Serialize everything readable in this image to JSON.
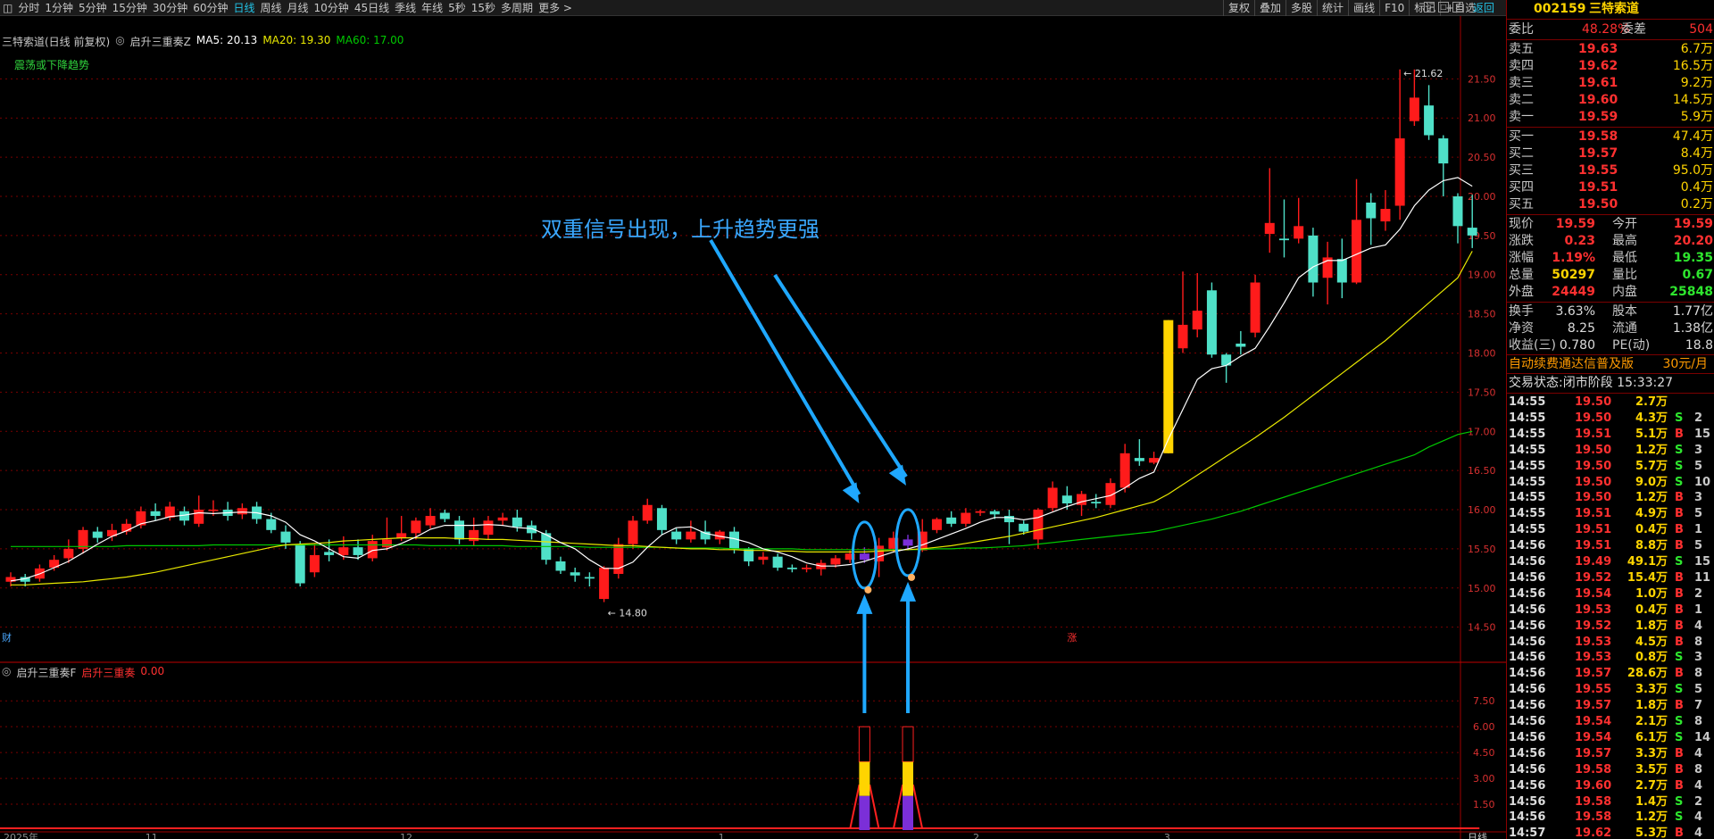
{
  "toolbar": {
    "periods": [
      "分时",
      "1分钟",
      "5分钟",
      "15分钟",
      "30分钟",
      "60分钟",
      "日线",
      "周线",
      "月线",
      "10分钟",
      "45日线",
      "季线",
      "年线",
      "5秒",
      "15秒",
      "多周期",
      "更多 >"
    ],
    "active_period": "日线",
    "tools": [
      "复权",
      "叠加",
      "多股",
      "统计",
      "画线",
      "F10",
      "标记",
      "+自选"
    ],
    "back": "返回"
  },
  "chart_header": {
    "title": "三特索道(日线 前复权)",
    "indicator": "启升三重奏Z",
    "ma5": "MA5: 20.13",
    "ma20": "MA20: 19.30",
    "ma60": "MA60: 17.00",
    "trend_label": "震荡或下降趋势",
    "annotation": "双重信号出现，上升趋势更强",
    "high_label": "21.62",
    "low_label": "14.80",
    "finance_marker": "财",
    "rise_marker": "涨",
    "sub_title": "启升三重奏F",
    "sub_name": "启升三重奏",
    "sub_value": "0.00",
    "axis_bottom": [
      "2025年",
      "11",
      "12",
      "1",
      "2",
      "3"
    ],
    "axis_corner": "日线"
  },
  "chart_data": {
    "type": "candlestick",
    "price_axis": [
      "21.50",
      "21.00",
      "20.50",
      "20.00",
      "19.50",
      "19.00",
      "18.50",
      "18.00",
      "17.50",
      "17.00",
      "16.50",
      "16.00",
      "15.50",
      "15.00",
      "14.50"
    ],
    "sub_axis": [
      "7.50",
      "6.00",
      "4.50",
      "3.00",
      "1.50"
    ],
    "ylim": [
      14.2,
      21.8
    ],
    "colors": {
      "up": "#ff1b1b",
      "down": "#4fe0c8",
      "ma5": "#ffffff",
      "ma20": "#e8e800",
      "ma60": "#00c800",
      "signal": "#7b2fd8",
      "limit": "#ffd400"
    },
    "candles": [
      [
        15.08,
        15.14,
        15.2,
        15.02
      ],
      [
        15.14,
        15.08,
        15.18,
        15.02
      ],
      [
        15.12,
        15.25,
        15.3,
        15.08
      ],
      [
        15.26,
        15.36,
        15.42,
        15.22
      ],
      [
        15.38,
        15.5,
        15.62,
        15.32
      ],
      [
        15.5,
        15.74,
        15.78,
        15.44
      ],
      [
        15.72,
        15.64,
        15.78,
        15.58
      ],
      [
        15.66,
        15.74,
        15.82,
        15.6
      ],
      [
        15.72,
        15.82,
        15.88,
        15.68
      ],
      [
        15.8,
        15.98,
        16.04,
        15.76
      ],
      [
        15.98,
        15.92,
        16.08,
        15.86
      ],
      [
        15.9,
        16.04,
        16.1,
        15.86
      ],
      [
        15.98,
        15.86,
        16.04,
        15.8
      ],
      [
        15.82,
        16.0,
        16.18,
        15.78
      ],
      [
        16.0,
        16.0,
        16.12,
        15.92
      ],
      [
        16.0,
        15.92,
        16.1,
        15.86
      ],
      [
        15.94,
        16.02,
        16.08,
        15.88
      ],
      [
        16.04,
        15.88,
        16.1,
        15.82
      ],
      [
        15.88,
        15.74,
        15.96,
        15.7
      ],
      [
        15.72,
        15.58,
        15.8,
        15.5
      ],
      [
        15.56,
        15.06,
        15.6,
        15.02
      ],
      [
        15.2,
        15.42,
        15.56,
        15.14
      ],
      [
        15.46,
        15.42,
        15.62,
        15.34
      ],
      [
        15.42,
        15.52,
        15.66,
        15.36
      ],
      [
        15.52,
        15.42,
        15.62,
        15.36
      ],
      [
        15.38,
        15.6,
        15.68,
        15.34
      ],
      [
        15.52,
        15.62,
        15.9,
        15.48
      ],
      [
        15.64,
        15.7,
        15.92,
        15.6
      ],
      [
        15.7,
        15.86,
        15.9,
        15.62
      ],
      [
        15.8,
        15.92,
        16.02,
        15.76
      ],
      [
        15.96,
        15.88,
        16.0,
        15.84
      ],
      [
        15.86,
        15.62,
        15.92,
        15.56
      ],
      [
        15.6,
        15.74,
        15.9,
        15.54
      ],
      [
        15.68,
        15.86,
        15.92,
        15.62
      ],
      [
        15.86,
        15.9,
        15.96,
        15.8
      ],
      [
        15.9,
        15.78,
        16.0,
        15.72
      ],
      [
        15.8,
        15.7,
        15.86,
        15.62
      ],
      [
        15.7,
        15.36,
        15.74,
        15.3
      ],
      [
        15.34,
        15.22,
        15.4,
        15.18
      ],
      [
        15.2,
        15.16,
        15.26,
        15.08
      ],
      [
        15.14,
        15.12,
        15.2,
        15.02
      ],
      [
        14.86,
        15.26,
        15.28,
        14.82
      ],
      [
        15.18,
        15.56,
        15.64,
        15.12
      ],
      [
        15.56,
        15.86,
        15.92,
        15.5
      ],
      [
        15.86,
        16.06,
        16.14,
        15.82
      ],
      [
        16.02,
        15.74,
        16.06,
        15.68
      ],
      [
        15.72,
        15.62,
        15.76,
        15.56
      ],
      [
        15.62,
        15.72,
        15.86,
        15.58
      ],
      [
        15.72,
        15.62,
        15.86,
        15.56
      ],
      [
        15.62,
        15.72,
        15.74,
        15.56
      ],
      [
        15.72,
        15.5,
        15.78,
        15.44
      ],
      [
        15.5,
        15.34,
        15.52,
        15.28
      ],
      [
        15.36,
        15.4,
        15.46,
        15.3
      ],
      [
        15.4,
        15.26,
        15.44,
        15.22
      ],
      [
        15.26,
        15.24,
        15.3,
        15.2
      ],
      [
        15.24,
        15.26,
        15.3,
        15.2
      ],
      [
        15.24,
        15.32,
        15.36,
        15.16
      ],
      [
        15.3,
        15.38,
        15.42,
        15.26
      ],
      [
        15.36,
        15.44,
        15.48,
        15.32
      ],
      [
        15.36,
        15.44,
        15.52,
        15.32
      ],
      [
        15.34,
        15.54,
        15.64,
        15.14
      ],
      [
        15.5,
        15.64,
        15.72,
        15.46
      ],
      [
        15.62,
        15.54,
        15.68,
        15.48
      ],
      [
        15.48,
        15.72,
        15.88,
        15.46
      ],
      [
        15.74,
        15.88,
        15.9,
        15.7
      ],
      [
        15.9,
        15.82,
        15.98,
        15.78
      ],
      [
        15.82,
        15.96,
        16.02,
        15.78
      ],
      [
        15.96,
        15.98,
        16.0,
        15.92
      ],
      [
        15.98,
        15.94,
        16.0,
        15.88
      ],
      [
        15.92,
        15.84,
        16.0,
        15.56
      ],
      [
        15.82,
        15.72,
        15.86,
        15.68
      ],
      [
        15.62,
        16.0,
        16.02,
        15.5
      ],
      [
        16.02,
        16.28,
        16.36,
        15.98
      ],
      [
        16.18,
        16.08,
        16.3,
        16.0
      ],
      [
        16.06,
        16.2,
        16.24,
        15.92
      ],
      [
        16.1,
        16.08,
        16.2,
        16.02
      ],
      [
        16.06,
        16.34,
        16.4,
        16.02
      ],
      [
        16.28,
        16.72,
        16.84,
        16.22
      ],
      [
        16.66,
        16.62,
        16.9,
        16.56
      ],
      [
        16.6,
        16.66,
        16.74,
        16.58
      ],
      [
        16.72,
        18.42,
        18.42,
        16.72
      ],
      [
        18.06,
        18.36,
        19.04,
        18.0
      ],
      [
        18.3,
        18.54,
        19.02,
        18.2
      ],
      [
        18.8,
        17.98,
        18.9,
        17.94
      ],
      [
        17.98,
        17.84,
        18.0,
        17.62
      ],
      [
        18.12,
        18.08,
        18.28,
        17.98
      ],
      [
        18.26,
        18.9,
        19.0,
        18.2
      ],
      [
        19.52,
        19.66,
        20.36,
        19.28
      ],
      [
        19.46,
        19.44,
        19.96,
        19.22
      ],
      [
        19.46,
        19.62,
        19.98,
        19.4
      ],
      [
        19.5,
        18.9,
        19.6,
        18.72
      ],
      [
        18.96,
        19.22,
        19.42,
        18.62
      ],
      [
        19.2,
        18.9,
        19.46,
        18.7
      ],
      [
        18.9,
        19.7,
        20.22,
        18.88
      ],
      [
        19.92,
        19.72,
        20.04,
        19.38
      ],
      [
        19.68,
        19.84,
        20.08,
        19.56
      ],
      [
        19.88,
        20.74,
        21.62,
        19.7
      ],
      [
        20.96,
        21.26,
        21.62,
        20.9
      ],
      [
        21.16,
        20.78,
        21.42,
        20.72
      ],
      [
        20.74,
        20.42,
        20.78,
        20.0
      ],
      [
        20.0,
        19.62,
        20.04,
        19.4
      ],
      [
        19.6,
        19.5,
        20.02,
        19.34
      ]
    ],
    "ma5": [
      15.09,
      15.12,
      15.18,
      15.26,
      15.34,
      15.45,
      15.56,
      15.66,
      15.73,
      15.82,
      15.86,
      15.91,
      15.93,
      15.96,
      15.95,
      15.96,
      15.97,
      15.96,
      15.92,
      15.84,
      15.68,
      15.6,
      15.5,
      15.4,
      15.38,
      15.48,
      15.5,
      15.57,
      15.65,
      15.75,
      15.8,
      15.8,
      15.8,
      15.81,
      15.8,
      15.77,
      15.76,
      15.68,
      15.58,
      15.5,
      15.36,
      15.25,
      15.25,
      15.33,
      15.52,
      15.68,
      15.77,
      15.78,
      15.7,
      15.66,
      15.63,
      15.58,
      15.5,
      15.46,
      15.4,
      15.32,
      15.28,
      15.28,
      15.3,
      15.34,
      15.4,
      15.46,
      15.5,
      15.55,
      15.62,
      15.69,
      15.76,
      15.84,
      15.9,
      15.9,
      15.87,
      15.9,
      15.97,
      16.04,
      16.1,
      16.14,
      16.18,
      16.28,
      16.4,
      16.48,
      16.9,
      17.28,
      17.66,
      17.8,
      17.84,
      17.96,
      18.06,
      18.34,
      18.64,
      18.96,
      19.1,
      19.18,
      19.18,
      19.26,
      19.34,
      19.38,
      19.58,
      19.88,
      20.08,
      20.2,
      20.24,
      20.13
    ],
    "ma20": [
      15.04,
      15.04,
      15.05,
      15.06,
      15.07,
      15.08,
      15.1,
      15.12,
      15.14,
      15.17,
      15.2,
      15.24,
      15.28,
      15.32,
      15.36,
      15.4,
      15.44,
      15.48,
      15.52,
      15.55,
      15.56,
      15.57,
      15.58,
      15.6,
      15.61,
      15.62,
      15.63,
      15.64,
      15.64,
      15.64,
      15.64,
      15.63,
      15.63,
      15.62,
      15.62,
      15.61,
      15.6,
      15.59,
      15.58,
      15.57,
      15.56,
      15.55,
      15.54,
      15.54,
      15.53,
      15.52,
      15.51,
      15.5,
      15.5,
      15.49,
      15.49,
      15.48,
      15.48,
      15.47,
      15.47,
      15.46,
      15.46,
      15.46,
      15.46,
      15.46,
      15.47,
      15.48,
      15.49,
      15.5,
      15.52,
      15.54,
      15.57,
      15.6,
      15.63,
      15.66,
      15.7,
      15.74,
      15.78,
      15.82,
      15.86,
      15.9,
      15.95,
      16.0,
      16.05,
      16.1,
      16.2,
      16.32,
      16.44,
      16.56,
      16.68,
      16.8,
      16.92,
      17.05,
      17.18,
      17.32,
      17.46,
      17.6,
      17.74,
      17.88,
      18.02,
      18.16,
      18.32,
      18.48,
      18.64,
      18.8,
      18.96,
      19.3
    ],
    "ma60": [
      15.53,
      15.53,
      15.53,
      15.53,
      15.53,
      15.53,
      15.53,
      15.53,
      15.54,
      15.54,
      15.54,
      15.54,
      15.54,
      15.54,
      15.55,
      15.55,
      15.55,
      15.55,
      15.55,
      15.55,
      15.55,
      15.55,
      15.55,
      15.55,
      15.55,
      15.55,
      15.55,
      15.55,
      15.55,
      15.54,
      15.54,
      15.54,
      15.54,
      15.54,
      15.54,
      15.53,
      15.53,
      15.53,
      15.53,
      15.53,
      15.52,
      15.52,
      15.52,
      15.52,
      15.52,
      15.52,
      15.51,
      15.51,
      15.51,
      15.51,
      15.5,
      15.5,
      15.5,
      15.5,
      15.5,
      15.49,
      15.49,
      15.49,
      15.49,
      15.49,
      15.49,
      15.49,
      15.49,
      15.49,
      15.5,
      15.5,
      15.51,
      15.51,
      15.52,
      15.53,
      15.54,
      15.56,
      15.58,
      15.6,
      15.62,
      15.64,
      15.66,
      15.68,
      15.7,
      15.72,
      15.76,
      15.8,
      15.84,
      15.88,
      15.93,
      15.98,
      16.04,
      16.1,
      16.16,
      16.22,
      16.28,
      16.34,
      16.4,
      16.46,
      16.52,
      16.58,
      16.64,
      16.7,
      16.8,
      16.88,
      16.96,
      17.0
    ],
    "signals": [
      59,
      62
    ],
    "sub_bars": [
      {
        "index": 59,
        "value": 6.0
      },
      {
        "index": 62,
        "value": 6.0
      }
    ]
  },
  "panel": {
    "code": "002159",
    "name": "三特索道",
    "wb_label": "委比",
    "wb_value": "48.28%",
    "wc_label": "委差",
    "wc_value": "504",
    "asks": [
      {
        "label": "卖五",
        "price": "19.63",
        "vol": "6.7万"
      },
      {
        "label": "卖四",
        "price": "19.62",
        "vol": "16.5万"
      },
      {
        "label": "卖三",
        "price": "19.61",
        "vol": "9.2万"
      },
      {
        "label": "卖二",
        "price": "19.60",
        "vol": "14.5万"
      },
      {
        "label": "卖一",
        "price": "19.59",
        "vol": "5.9万"
      }
    ],
    "bids": [
      {
        "label": "买一",
        "price": "19.58",
        "vol": "47.4万"
      },
      {
        "label": "买二",
        "price": "19.57",
        "vol": "8.4万"
      },
      {
        "label": "买三",
        "price": "19.55",
        "vol": "95.0万"
      },
      {
        "label": "买四",
        "price": "19.51",
        "vol": "0.4万"
      },
      {
        "label": "买五",
        "price": "19.50",
        "vol": "0.2万"
      }
    ],
    "stats": [
      {
        "l1": "现价",
        "v1": "19.59",
        "c1": "#ff3030",
        "l2": "今开",
        "v2": "19.59",
        "c2": "#ff3030"
      },
      {
        "l1": "涨跌",
        "v1": "0.23",
        "c1": "#ff3030",
        "l2": "最高",
        "v2": "20.20",
        "c2": "#ff3030"
      },
      {
        "l1": "涨幅",
        "v1": "1.19%",
        "c1": "#ff3030",
        "l2": "最低",
        "v2": "19.35",
        "c2": "#2ee62e"
      },
      {
        "l1": "总量",
        "v1": "50297",
        "c1": "#ffd400",
        "l2": "量比",
        "v2": "0.67",
        "c2": "#2ee62e"
      },
      {
        "l1": "外盘",
        "v1": "24449",
        "c1": "#ff3030",
        "l2": "内盘",
        "v2": "25848",
        "c2": "#2ee62e"
      }
    ],
    "stats2": [
      {
        "l1": "换手",
        "v1": "3.63%",
        "l2": "股本",
        "v2": "1.77亿"
      },
      {
        "l1": "净资",
        "v1": "8.25",
        "l2": "流通",
        "v2": "1.38亿"
      },
      {
        "l1": "收益(三)",
        "v1": "0.780",
        "l2": "PE(动)",
        "v2": "18.8"
      }
    ],
    "ad_text": "自动续费通达信普及版",
    "ad_price": "30元/月",
    "status": "交易状态:闭市阶段 15:33:27",
    "ticks": [
      [
        "14:55",
        "19.50",
        "2.7万",
        "",
        ""
      ],
      [
        "14:55",
        "19.50",
        "4.3万",
        "S",
        "2"
      ],
      [
        "14:55",
        "19.51",
        "5.1万",
        "B",
        "15"
      ],
      [
        "14:55",
        "19.50",
        "1.2万",
        "S",
        "3"
      ],
      [
        "14:55",
        "19.50",
        "5.7万",
        "S",
        "5"
      ],
      [
        "14:55",
        "19.50",
        "9.0万",
        "S",
        "10"
      ],
      [
        "14:55",
        "19.50",
        "1.2万",
        "B",
        "3"
      ],
      [
        "14:55",
        "19.51",
        "4.9万",
        "B",
        "5"
      ],
      [
        "14:55",
        "19.51",
        "0.4万",
        "B",
        "1"
      ],
      [
        "14:56",
        "19.51",
        "8.8万",
        "B",
        "5"
      ],
      [
        "14:56",
        "19.49",
        "49.1万",
        "S",
        "15"
      ],
      [
        "14:56",
        "19.52",
        "15.4万",
        "B",
        "11"
      ],
      [
        "14:56",
        "19.54",
        "1.0万",
        "B",
        "2"
      ],
      [
        "14:56",
        "19.53",
        "0.4万",
        "B",
        "1"
      ],
      [
        "14:56",
        "19.52",
        "1.8万",
        "B",
        "4"
      ],
      [
        "14:56",
        "19.53",
        "4.5万",
        "B",
        "8"
      ],
      [
        "14:56",
        "19.53",
        "0.8万",
        "S",
        "3"
      ],
      [
        "14:56",
        "19.57",
        "28.6万",
        "B",
        "8"
      ],
      [
        "14:56",
        "19.55",
        "3.3万",
        "S",
        "5"
      ],
      [
        "14:56",
        "19.57",
        "1.8万",
        "B",
        "7"
      ],
      [
        "14:56",
        "19.54",
        "2.1万",
        "S",
        "8"
      ],
      [
        "14:56",
        "19.54",
        "6.1万",
        "S",
        "14"
      ],
      [
        "14:56",
        "19.57",
        "3.3万",
        "B",
        "4"
      ],
      [
        "14:56",
        "19.58",
        "3.5万",
        "B",
        "8"
      ],
      [
        "14:56",
        "19.60",
        "2.7万",
        "B",
        "4"
      ],
      [
        "14:56",
        "19.58",
        "1.4万",
        "S",
        "2"
      ],
      [
        "14:56",
        "19.58",
        "1.2万",
        "S",
        "4"
      ],
      [
        "14:57",
        "19.62",
        "5.3万",
        "B",
        "4"
      ]
    ]
  }
}
